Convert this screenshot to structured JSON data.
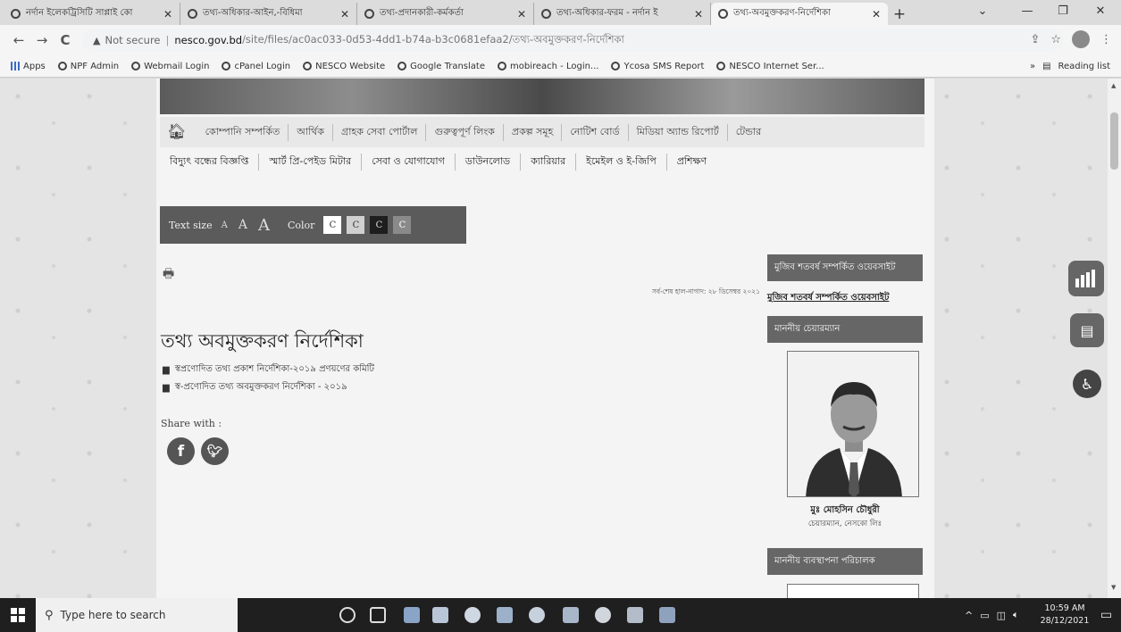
{
  "browser": {
    "tabs": [
      {
        "label": "নর্দান ইলেকট্রিসিটি সাপ্লাই কো",
        "active": false
      },
      {
        "label": "তথ্য-অধিকার-আইন,-বিধিমা",
        "active": false
      },
      {
        "label": "তথ্য-প্রদানকারী-কর্মকর্তা",
        "active": false
      },
      {
        "label": "তথ্য-অধিকার-ফরম - নর্দান ই",
        "active": false
      },
      {
        "label": "তথ্য-অবমুক্তকরণ-নির্দেশিকা",
        "active": true
      }
    ],
    "new_tab": "+",
    "address": {
      "security": "Not secure",
      "host": "nesco.gov.bd",
      "path": "/site/files/ac0ac033-0d53-4dd1-b74a-b3c0681efaa2/তথ্য-অবমুক্তকরণ-নির্দেশিকা"
    },
    "bookmarks": [
      "Apps",
      "NPF Admin",
      "Webmail Login",
      "cPanel Login",
      "NESCO Website",
      "Google Translate",
      "mobireach - Login...",
      "Ycosa SMS Report",
      "NESCO Internet Ser..."
    ],
    "bookmarks_more": "»",
    "reading_list": "Reading list"
  },
  "site": {
    "menu1": [
      "কোম্পানি সম্পর্কিত",
      "আর্থিক",
      "গ্রাহক সেবা পোর্টাল",
      "গুরুত্বপূর্ণ লিংক",
      "প্রকল্প সমূহ",
      "নোটিশ বোর্ড",
      "মিডিয়া অ্যান্ড রিপোর্ট",
      "টেন্ডার"
    ],
    "menu2": [
      "বিদ্যুৎ বন্ধের বিজ্ঞপ্তি",
      "স্মার্ট প্রি-পেইড মিটার",
      "সেবা ও যোগাযোগ",
      "ডাউনলোড",
      "ক্যারিয়ার",
      "ইমেইল ও ই-জিপি",
      "প্রশিক্ষণ"
    ],
    "text_size_label": "Text size",
    "text_size_small": "A",
    "text_size_medium": "A",
    "text_size_large": "A",
    "color_label": "Color",
    "color_swatch_letter": "C",
    "color_swatches": [
      "#ffffff",
      "#d0d0d0",
      "#1e1e1e",
      "#8a8a8a"
    ],
    "last_updated": "সর্ব-শেষ হাল-নাগাদ: ২৮ ডিসেম্বর ২০২১",
    "page_title": "তথ্য অবমুক্তকরণ নির্দেশিকা",
    "documents": [
      "স্বপ্রণোদিত তথ্য প্রকাশ নির্দেশিকা-২০১৯ প্রণয়ণের কমিটি",
      "স্ব-প্রণোদিত তথ্য অবমুক্তকরণ নির্দেশিকা - ২০১৯"
    ],
    "share_label": "Share with :",
    "sidebar": {
      "head1": "মুজিব শতবর্ষ সম্পর্কিত ওয়েবসাইট",
      "link1": "মুজিব শতবর্ষ সম্পর্কিত ওয়েবসাইট",
      "head2": "মাননীয় চেয়ারম্যান",
      "chairman_name": "মুঃ মোহসিন চৌধুরী",
      "chairman_title": "চেয়ারম্যান, নেসকো লিঃ",
      "head3": "মাননীয় ব্যবস্থাপনা পরিচালক"
    }
  },
  "taskbar": {
    "search_placeholder": "Type here to search",
    "time": "10:59 AM",
    "date": "28/12/2021"
  }
}
